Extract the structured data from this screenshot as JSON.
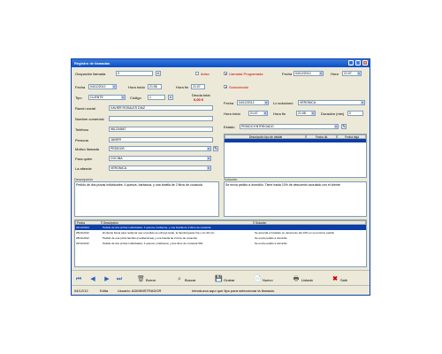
{
  "window": {
    "title": "Registro de llamadas"
  },
  "left": {
    "ocupacion_label": "Ocupación llamada",
    "ocupacion_value": "0",
    "fecha_label": "Fecha",
    "fecha_value": "04/12/2012",
    "hora_inicio_label": "Hora inicio",
    "hora_inicio_value": "21:56",
    "hora_fin_label": "Hora fin",
    "hora_fin_value": "21:07",
    "tipo_label": "Tipo",
    "tipo_value": "CLIENTE",
    "codigo_label": "Código",
    "codigo_value": "1",
    "deuda_label": "Deuda total",
    "deuda_value": "0,00 €",
    "razon_label": "Razón social",
    "razon_value": "XAVIER ROSALES DIAZ",
    "nombre_label": "Nombre comercial",
    "nombre_value": "",
    "telefono_label": "Teléfono",
    "telefono_value": "961234567",
    "persona_label": "Persona",
    "persona_value": "JAVIER",
    "motivo_label": "Motivo llamada",
    "motivo_value": "PEDIDOS",
    "para_label": "Para quién",
    "para_value": "COCINA",
    "atiende_label": "La atiende",
    "atiende_value": "VERONICA"
  },
  "right": {
    "aviso_label": "Aviso",
    "llamada_label": "Llamada Programada",
    "fecha_label": "Fecha",
    "fecha_value": "04/12/2012",
    "hora_label": "Hora",
    "hora_value": "21:07",
    "solucionado_label": "Solucionado",
    "fecha2_label": "Fecha",
    "fecha2_value": "04/12/2012",
    "soluciono_label": "Lo solucionó",
    "soluciono_value": "VERONICA",
    "horainicio_label": "Hora inicio",
    "horainicio_value": "21:07",
    "horafin_label": "Hora fin",
    "horafin_value": "21:08",
    "duracion_label": "Duración (min)",
    "duracion_value": "0",
    "estado_label": "Estado",
    "estado_value": "PEDIDO ENTREGADO"
  },
  "detalle": {
    "headers": [
      "Descripción tipo de detalle",
      "Fecha últ.",
      "Fecha baja"
    ]
  },
  "descripcion": {
    "label": "Descripción",
    "text": "Pedido de dos pizzas individuales: 4 quesos, barbacoa, y una botella de 2 litros de cocacola"
  },
  "solucion": {
    "label": "Solución",
    "text": "Se envía pedido a domicilio. Tiene hasta 10% de descuento acordado con el cliente"
  },
  "history": {
    "headers": [
      "Fecha",
      "Descripción",
      "Solución"
    ],
    "rows": [
      {
        "fecha": "04/12/2012",
        "desc": "Pedido de dos pizzas individuales: 4 quesos, barbacoa, y una botella de 2 litros de cocacola",
        "sol": "",
        "selected": true
      },
      {
        "fecha": "28/11/2012",
        "desc": "El cliente llama para reclamar que el pedido se entregó tarde, la hamburguesa fría y sin 40 min",
        "sol": "Se acuerda el traslado en descuento del 10% en su próximo pedido",
        "selected": false
      },
      {
        "fecha": "28/11/2012",
        "desc": "Pedido de una pizza familiar (mediterránea) y una botella de 2 litros de cocacola",
        "sol": "Se envía pedido a domicilio",
        "selected": false
      },
      {
        "fecha": "22/11/2012",
        "desc": "Pedido de dos pizzas individuales: 4 quesos y barbacoa, y dos litros de cocacola 500",
        "sol": "Se envía pedido a domicilio",
        "selected": false
      }
    ]
  },
  "nav": {
    "borrar": "Borrar",
    "buscar": "Buscar",
    "grabar": "Grabar",
    "nuevo": "Nuevo",
    "listado": "Listado",
    "salir": "Salir"
  },
  "status": {
    "fecha": "04/12/12",
    "modo": "Edita",
    "usuario": "Usuario: ADMINISTRADOR",
    "mensaje": "Introduzca aquí que tipo para seleccionar la llamada."
  }
}
